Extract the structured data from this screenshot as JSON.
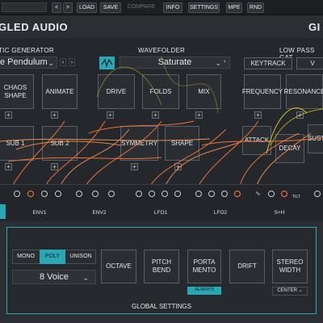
{
  "toolbar": {
    "prev": "<",
    "next": ">",
    "load": "LOAD",
    "save": "SAVE",
    "compare": "COMPARE",
    "info": "INFO",
    "settings": "SETTINGS",
    "mpe": "MPE",
    "rnd": "RND"
  },
  "header": {
    "brand_left": "GLED AUDIO",
    "brand_right": "GI"
  },
  "sections": {
    "chaotic": "TIC GENERATOR",
    "wavefolder": "WAVEFOLDER",
    "lowpass": "LOW PASS GAT"
  },
  "chaotic": {
    "preset": "e Pendulum",
    "chaos_shape": "CHAOS\nSHAPE",
    "animate": "ANIMATE",
    "sub1": "SUB 1",
    "sub2": "SUB 2"
  },
  "wavefolder": {
    "preset": "Saturate",
    "drive": "DRIVE",
    "folds": "FOLDS",
    "mix": "MIX",
    "symmetry": "SYMMETRY",
    "shape": "SHAPE"
  },
  "lowpass": {
    "keytrack": "KEYTRACK",
    "frequency": "FREQUENCY",
    "resonance": "RESONANCE",
    "attack": "ATTACK",
    "decay": "DECAY",
    "sustain": "SUSTA",
    "v": "V"
  },
  "sources": {
    "env1": "ENV1",
    "env2": "ENV2",
    "lfo1": "LFO1",
    "lfo2": "LFO2",
    "sh": "S+H",
    "tilt": "TILT"
  },
  "global": {
    "title": "GLOBAL SETTINGS",
    "mono": "MONO",
    "poly": "POLY",
    "unison": "UNISON",
    "voices": "8 Voice",
    "octave": "OCTAVE",
    "pitch_bend": "PITCH\nBEND",
    "portamento": "PORTA\nMENTO",
    "always": "ALWAYS",
    "drift": "DRIFT",
    "stereo_width": "STEREO\nWIDTH",
    "center": "CENTER"
  },
  "colors": {
    "accent": "#2aa7b5",
    "cable_orange": "#ff7a3a",
    "cable_yellow": "#e8c832"
  }
}
